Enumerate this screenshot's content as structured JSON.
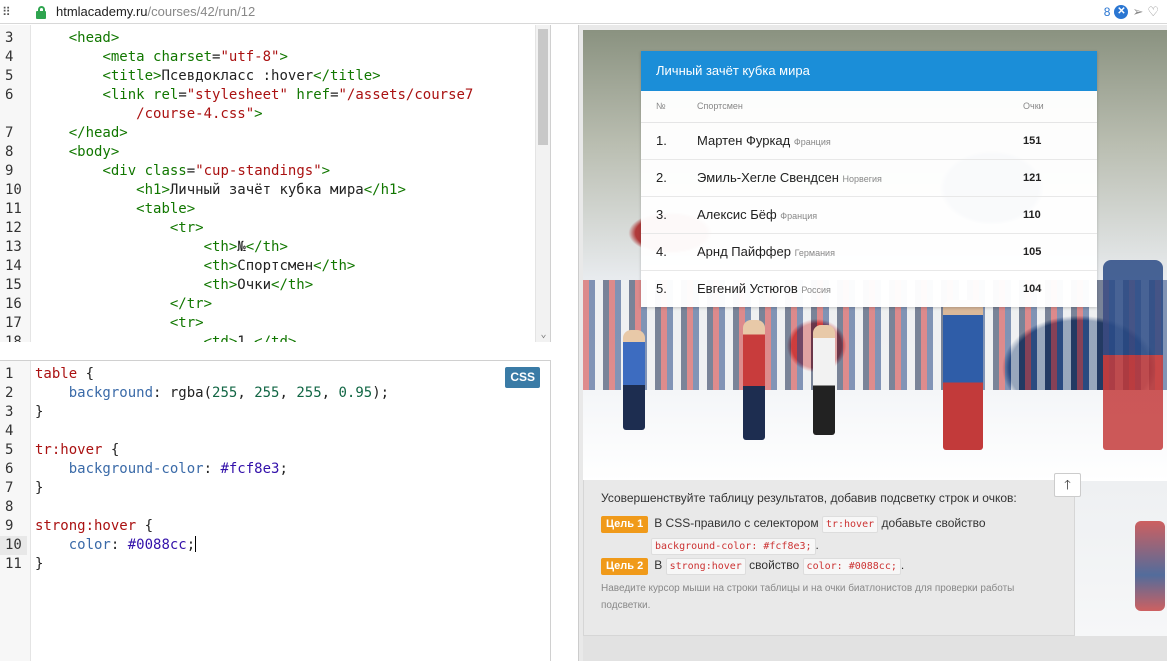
{
  "browser": {
    "url_host": "htmlacademy.ru",
    "url_path": "/courses/42/run/12",
    "badge_count": "8"
  },
  "html_editor": {
    "lines": [
      {
        "n": "3",
        "parts": [
          [
            "br",
            "    "
          ],
          [
            "tag",
            "<head>"
          ]
        ]
      },
      {
        "n": "4",
        "parts": [
          [
            "br",
            "        "
          ],
          [
            "tag",
            "<meta "
          ],
          [
            "attr",
            "charset"
          ],
          [
            "br",
            "="
          ],
          [
            "str",
            "\"utf-8\""
          ],
          [
            "tag",
            ">"
          ]
        ]
      },
      {
        "n": "5",
        "parts": [
          [
            "br",
            "        "
          ],
          [
            "tag",
            "<title>"
          ],
          [
            "br",
            "Псевдокласс :hover"
          ],
          [
            "tag",
            "</title>"
          ]
        ]
      },
      {
        "n": "6",
        "parts": [
          [
            "br",
            "        "
          ],
          [
            "tag",
            "<link "
          ],
          [
            "attr",
            "rel"
          ],
          [
            "br",
            "="
          ],
          [
            "str",
            "\"stylesheet\""
          ],
          [
            "br",
            " "
          ],
          [
            "attr",
            "href"
          ],
          [
            "br",
            "="
          ],
          [
            "str",
            "\"/assets/course7"
          ]
        ]
      },
      {
        "n": "",
        "parts": [
          [
            "str",
            "            /course-4.css\""
          ],
          [
            "tag",
            ">"
          ]
        ]
      },
      {
        "n": "7",
        "parts": [
          [
            "br",
            "    "
          ],
          [
            "tag",
            "</head>"
          ]
        ]
      },
      {
        "n": "8",
        "parts": [
          [
            "br",
            "    "
          ],
          [
            "tag",
            "<body>"
          ]
        ]
      },
      {
        "n": "9",
        "parts": [
          [
            "br",
            "        "
          ],
          [
            "tag",
            "<div "
          ],
          [
            "attr",
            "class"
          ],
          [
            "br",
            "="
          ],
          [
            "str",
            "\"cup-standings\""
          ],
          [
            "tag",
            ">"
          ]
        ]
      },
      {
        "n": "10",
        "parts": [
          [
            "br",
            "            "
          ],
          [
            "tag",
            "<h1>"
          ],
          [
            "br",
            "Личный зачёт кубка мира"
          ],
          [
            "tag",
            "</h1>"
          ]
        ]
      },
      {
        "n": "11",
        "parts": [
          [
            "br",
            "            "
          ],
          [
            "tag",
            "<table>"
          ]
        ]
      },
      {
        "n": "12",
        "parts": [
          [
            "br",
            "                "
          ],
          [
            "tag",
            "<tr>"
          ]
        ]
      },
      {
        "n": "13",
        "parts": [
          [
            "br",
            "                    "
          ],
          [
            "tag",
            "<th>"
          ],
          [
            "br",
            "№"
          ],
          [
            "tag",
            "</th>"
          ]
        ]
      },
      {
        "n": "14",
        "parts": [
          [
            "br",
            "                    "
          ],
          [
            "tag",
            "<th>"
          ],
          [
            "br",
            "Спортсмен"
          ],
          [
            "tag",
            "</th>"
          ]
        ]
      },
      {
        "n": "15",
        "parts": [
          [
            "br",
            "                    "
          ],
          [
            "tag",
            "<th>"
          ],
          [
            "br",
            "Очки"
          ],
          [
            "tag",
            "</th>"
          ]
        ]
      },
      {
        "n": "16",
        "parts": [
          [
            "br",
            "                "
          ],
          [
            "tag",
            "</tr>"
          ]
        ]
      },
      {
        "n": "17",
        "parts": [
          [
            "br",
            "                "
          ],
          [
            "tag",
            "<tr>"
          ]
        ]
      },
      {
        "n": "18",
        "parts": [
          [
            "br",
            "                    "
          ],
          [
            "tag",
            "<td>"
          ],
          [
            "br",
            "1."
          ],
          [
            "tag",
            "</td>"
          ]
        ]
      }
    ]
  },
  "css_editor": {
    "badge": "CSS",
    "lines": [
      {
        "n": "1",
        "parts": [
          [
            "sel",
            "table"
          ],
          [
            "br",
            " {"
          ]
        ]
      },
      {
        "n": "2",
        "parts": [
          [
            "br",
            "    "
          ],
          [
            "prop",
            "background"
          ],
          [
            "br",
            ": rgba("
          ],
          [
            "num",
            "255"
          ],
          [
            "br",
            ", "
          ],
          [
            "num",
            "255"
          ],
          [
            "br",
            ", "
          ],
          [
            "num",
            "255"
          ],
          [
            "br",
            ", "
          ],
          [
            "num",
            "0.95"
          ],
          [
            "br",
            ");"
          ]
        ]
      },
      {
        "n": "3",
        "parts": [
          [
            "br",
            "}"
          ]
        ]
      },
      {
        "n": "4",
        "parts": []
      },
      {
        "n": "5",
        "parts": [
          [
            "sel",
            "tr:hover"
          ],
          [
            "br",
            " {"
          ]
        ]
      },
      {
        "n": "6",
        "parts": [
          [
            "br",
            "    "
          ],
          [
            "prop",
            "background-color"
          ],
          [
            "br",
            ": "
          ],
          [
            "val",
            "#fcf8e3"
          ],
          [
            "br",
            ";"
          ]
        ]
      },
      {
        "n": "7",
        "parts": [
          [
            "br",
            "}"
          ]
        ]
      },
      {
        "n": "8",
        "parts": []
      },
      {
        "n": "9",
        "parts": [
          [
            "sel",
            "strong:hover"
          ],
          [
            "br",
            " {"
          ]
        ]
      },
      {
        "n": "10",
        "parts": [
          [
            "br",
            "    "
          ],
          [
            "prop",
            "color"
          ],
          [
            "br",
            ": "
          ],
          [
            "val",
            "#0088cc"
          ],
          [
            "br",
            ";"
          ]
        ],
        "active": true
      },
      {
        "n": "11",
        "parts": [
          [
            "br",
            "}"
          ]
        ]
      }
    ]
  },
  "standings": {
    "title": "Личный зачёт кубка мира",
    "headers": [
      "№",
      "Спортсмен",
      "Очки"
    ],
    "rows": [
      {
        "place": "1.",
        "name": "Мартен Фуркад",
        "country": "Франция",
        "points": "151"
      },
      {
        "place": "2.",
        "name": "Эмиль-Хегле Свендсен",
        "country": "Норвегия",
        "points": "121"
      },
      {
        "place": "3.",
        "name": "Алексис Бёф",
        "country": "Франция",
        "points": "110"
      },
      {
        "place": "4.",
        "name": "Арнд Пайффер",
        "country": "Германия",
        "points": "105"
      },
      {
        "place": "5.",
        "name": "Евгений Устюгов",
        "country": "Россия",
        "points": "104"
      }
    ]
  },
  "task": {
    "intro": "Усовершенствуйте таблицу результатов, добавив подсветку строк и очков:",
    "goal1_label": "Цель 1",
    "goal1_text_a": "В CSS-правило с селектором",
    "goal1_code_a": "tr:hover",
    "goal1_text_b": "добавьте свойство",
    "goal1_code_b": "background-color: #fcf8e3;",
    "goal1_tail": ".",
    "goal2_label": "Цель 2",
    "goal2_text_a": "В",
    "goal2_code_a": "strong:hover",
    "goal2_text_b": "свойство",
    "goal2_code_b": "color: #0088cc;",
    "goal2_tail": ".",
    "hint": "Наведите курсор мыши на строки таблицы и на очки биатлонистов для проверки работы подсветки.",
    "up_arrow": "🡑"
  },
  "colors": {
    "accent": "#1b8ed8",
    "goal_badge": "#f09a1a",
    "css_badge": "#3a7ba6"
  }
}
